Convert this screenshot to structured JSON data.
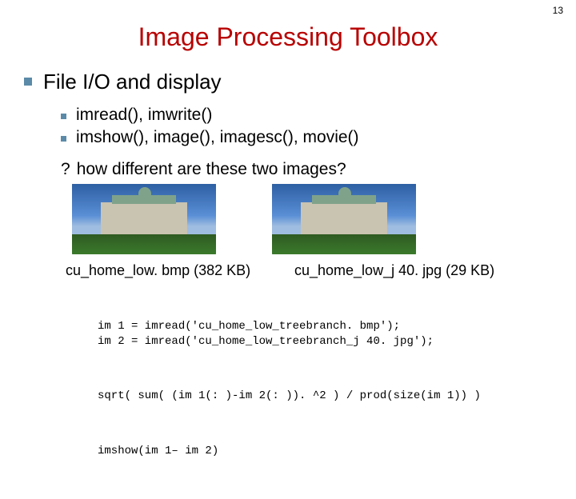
{
  "page_number": "13",
  "title": "Image Processing Toolbox",
  "heading": "File I/O and display",
  "sub_items": [
    "imread(), imwrite()",
    "imshow(), image(), imagesc(), movie()"
  ],
  "question_mark": "?",
  "question": "how different are these two images?",
  "caption1": "cu_home_low. bmp (382 KB)",
  "caption2": "cu_home_low_j 40. jpg (29 KB)",
  "code_block1": "im 1 = imread('cu_home_low_treebranch. bmp');\nim 2 = imread('cu_home_low_treebranch_j 40. jpg');",
  "code_block2": "sqrt( sum( (im 1(: )-im 2(: )). ^2 ) / prod(size(im 1)) )",
  "code_block3": "imshow(im 1– im 2)"
}
